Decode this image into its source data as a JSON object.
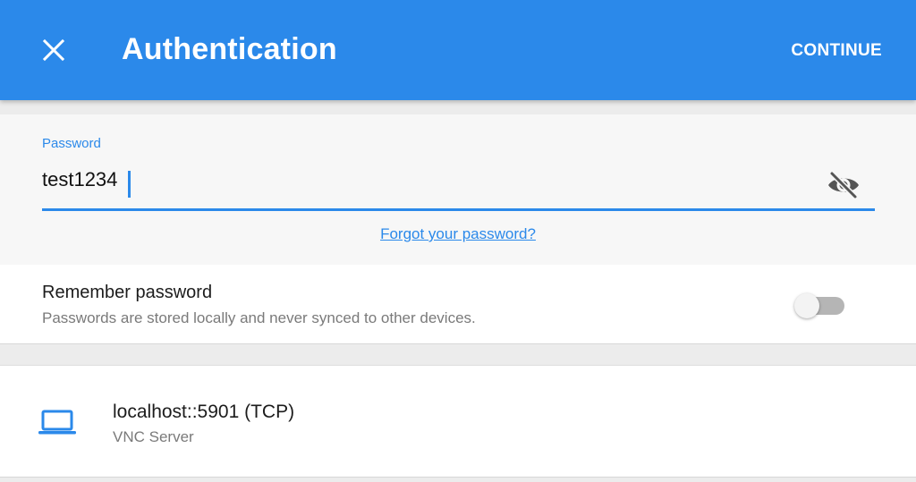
{
  "appbar": {
    "title": "Authentication",
    "continue_label": "CONTINUE",
    "close_icon": "close-icon",
    "color": "#2b89ea"
  },
  "password": {
    "label": "Password",
    "value": "test1234",
    "visibility_icon": "eye-off-icon",
    "forgot_link": "Forgot your password?"
  },
  "remember": {
    "title": "Remember password",
    "subtitle": "Passwords are stored locally and never synced to other devices.",
    "enabled": false
  },
  "server": {
    "icon": "laptop-icon",
    "address": "localhost::5901 (TCP)",
    "type": "VNC Server"
  }
}
